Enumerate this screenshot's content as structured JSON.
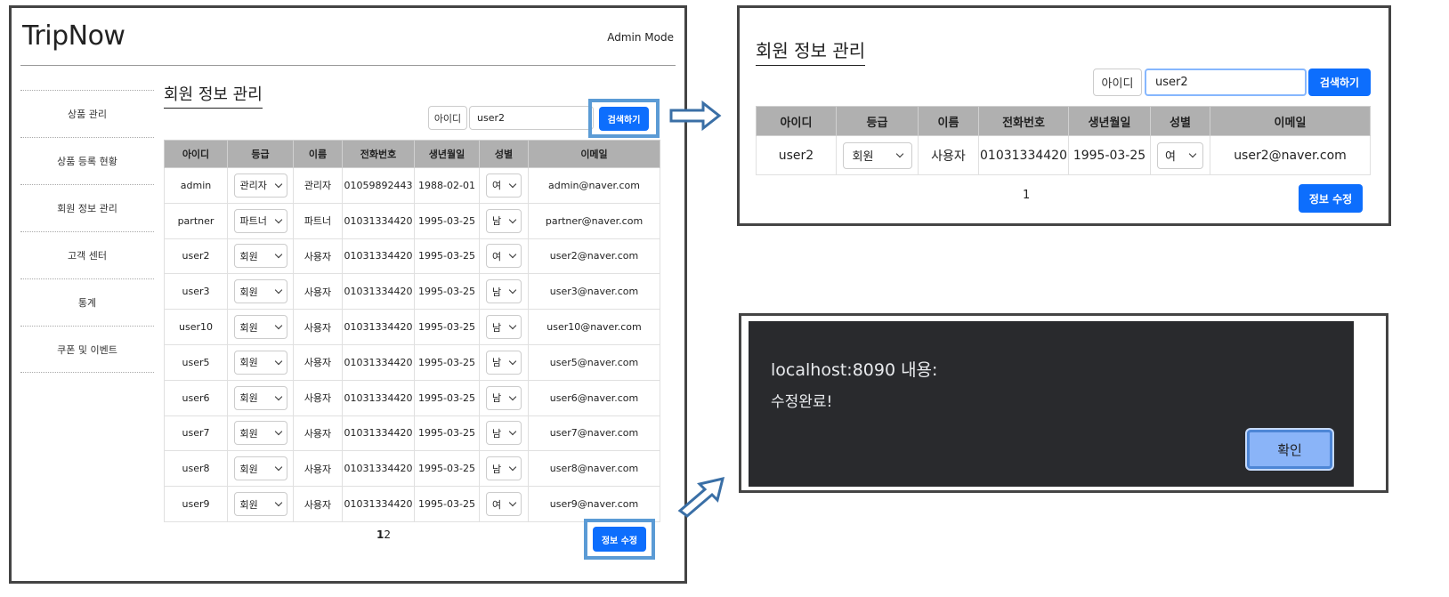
{
  "main": {
    "brand": "TripNow",
    "mode": "Admin Mode",
    "sidebar": [
      {
        "label": "상품 관리"
      },
      {
        "label": "상품 등록 현황"
      },
      {
        "label": "회원 정보 관리"
      },
      {
        "label": "고객 센터"
      },
      {
        "label": "통계"
      },
      {
        "label": "쿠폰 및 이벤트"
      }
    ],
    "page_title": "회원 정보 관리",
    "search": {
      "label": "아이디",
      "value": "user2",
      "button": "검색하기"
    },
    "columns": [
      "아이디",
      "등급",
      "이름",
      "전화번호",
      "생년월일",
      "성별",
      "이메일"
    ],
    "rows": [
      {
        "id": "admin",
        "grade": "관리자",
        "name": "관리자",
        "phone": "01059892443",
        "birth": "1988-02-01",
        "gender": "여",
        "email": "admin@naver.com"
      },
      {
        "id": "partner",
        "grade": "파트너",
        "name": "파트너",
        "phone": "01031334420",
        "birth": "1995-03-25",
        "gender": "남",
        "email": "partner@naver.com"
      },
      {
        "id": "user2",
        "grade": "회원",
        "name": "사용자",
        "phone": "01031334420",
        "birth": "1995-03-25",
        "gender": "여",
        "email": "user2@naver.com"
      },
      {
        "id": "user3",
        "grade": "회원",
        "name": "사용자",
        "phone": "01031334420",
        "birth": "1995-03-25",
        "gender": "남",
        "email": "user3@naver.com"
      },
      {
        "id": "user10",
        "grade": "회원",
        "name": "사용자",
        "phone": "01031334420",
        "birth": "1995-03-25",
        "gender": "남",
        "email": "user10@naver.com"
      },
      {
        "id": "user5",
        "grade": "회원",
        "name": "사용자",
        "phone": "01031334420",
        "birth": "1995-03-25",
        "gender": "남",
        "email": "user5@naver.com"
      },
      {
        "id": "user6",
        "grade": "회원",
        "name": "사용자",
        "phone": "01031334420",
        "birth": "1995-03-25",
        "gender": "남",
        "email": "user6@naver.com"
      },
      {
        "id": "user7",
        "grade": "회원",
        "name": "사용자",
        "phone": "01031334420",
        "birth": "1995-03-25",
        "gender": "남",
        "email": "user7@naver.com"
      },
      {
        "id": "user8",
        "grade": "회원",
        "name": "사용자",
        "phone": "01031334420",
        "birth": "1995-03-25",
        "gender": "남",
        "email": "user8@naver.com"
      },
      {
        "id": "user9",
        "grade": "회원",
        "name": "사용자",
        "phone": "01031334420",
        "birth": "1995-03-25",
        "gender": "여",
        "email": "user9@naver.com"
      }
    ],
    "pager": [
      "1",
      "2"
    ],
    "save_button": "정보 수정"
  },
  "result": {
    "page_title": "회원 정보 관리",
    "search": {
      "label": "아이디",
      "value": "user2",
      "button": "검색하기"
    },
    "columns": [
      "아이디",
      "등급",
      "이름",
      "전화번호",
      "생년월일",
      "성별",
      "이메일"
    ],
    "row": {
      "id": "user2",
      "grade": "회원",
      "name": "사용자",
      "phone": "01031334420",
      "birth": "1995-03-25",
      "gender": "여",
      "email": "user2@naver.com"
    },
    "pager": "1",
    "save_button": "정보 수정"
  },
  "alert": {
    "title": "localhost:8090 내용:",
    "message": "수정완료!",
    "ok_button": "확인"
  },
  "colors": {
    "primary_button": "#0d6efd",
    "highlight_box": "#5b9bd5",
    "table_header": "#b0b0b0",
    "dialog_bg": "#292a2d",
    "dialog_button": "#8ab4f8"
  }
}
